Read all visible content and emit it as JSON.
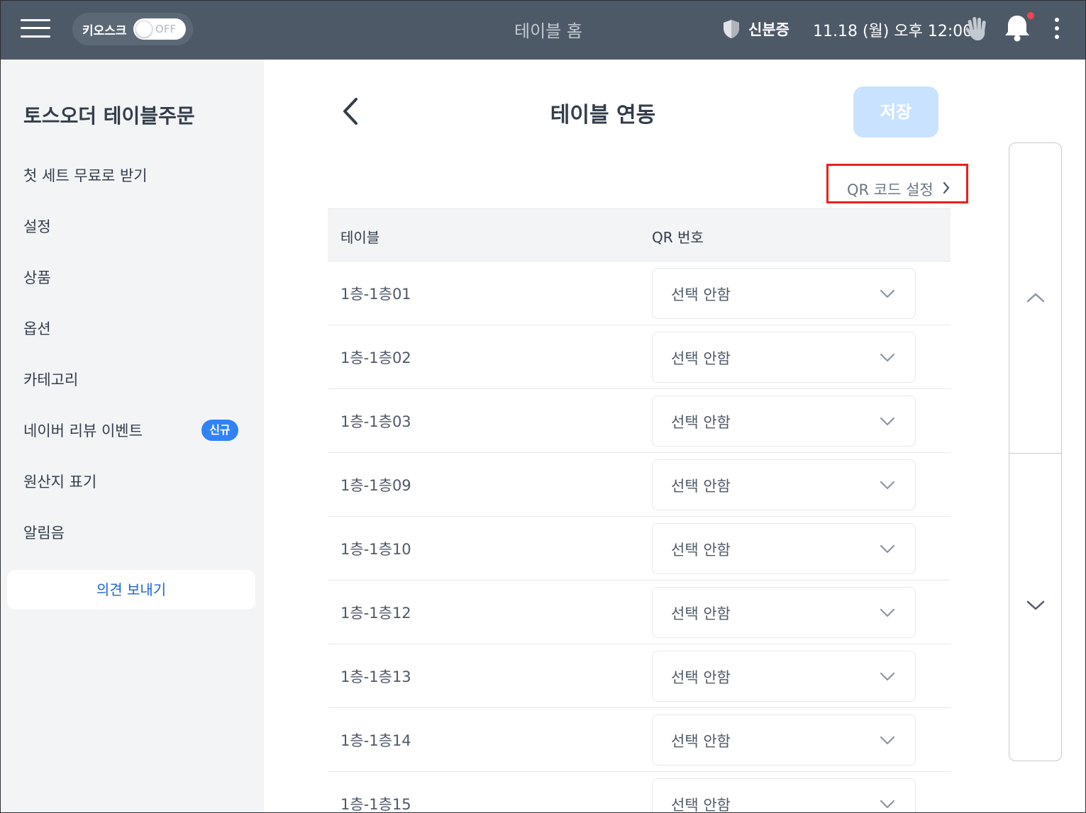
{
  "topbar": {
    "kiosk_label": "키오스크",
    "kiosk_toggle_text": "OFF",
    "title": "테이블 홈",
    "id_label": "신분증",
    "datetime": "11.18 (월) 오후 12:00",
    "icons": [
      "menu-icon",
      "shield-icon",
      "hand-icon",
      "bell-icon",
      "more-vertical-icon"
    ],
    "notification_dot_color": "#f04452"
  },
  "sidebar": {
    "title": "토스오더 테이블주문",
    "items": [
      {
        "label": "첫 세트 무료로 받기"
      },
      {
        "label": "설정"
      },
      {
        "label": "상품"
      },
      {
        "label": "옵션"
      },
      {
        "label": "카테고리"
      },
      {
        "label": "네이버 리뷰 이벤트",
        "badge": "신규"
      },
      {
        "label": "원산지 표기"
      },
      {
        "label": "알림음"
      }
    ],
    "feedback_label": "의견 보내기"
  },
  "main": {
    "title": "테이블 연동",
    "save_label": "저장",
    "qr_link_label": "QR 코드 설정",
    "table_headers": {
      "table": "테이블",
      "qr": "QR 번호"
    },
    "rows": [
      {
        "name": "1층-1층01",
        "qr": "선택 안함"
      },
      {
        "name": "1층-1층02",
        "qr": "선택 안함"
      },
      {
        "name": "1층-1층03",
        "qr": "선택 안함"
      },
      {
        "name": "1층-1층09",
        "qr": "선택 안함"
      },
      {
        "name": "1층-1층10",
        "qr": "선택 안함"
      },
      {
        "name": "1층-1층12",
        "qr": "선택 안함"
      },
      {
        "name": "1층-1층13",
        "qr": "선택 안함"
      },
      {
        "name": "1층-1층14",
        "qr": "선택 안함"
      },
      {
        "name": "1층-1층15",
        "qr": "선택 안함"
      }
    ]
  },
  "colors": {
    "topbar": "#4e5968",
    "accent": "#3182f6",
    "save_disabled": "#c9e2ff",
    "highlight_box": "#e8221c"
  }
}
